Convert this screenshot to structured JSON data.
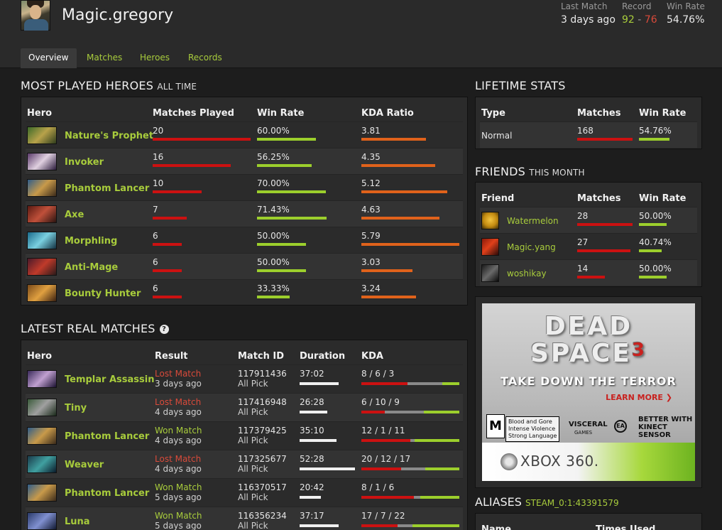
{
  "header": {
    "username": "Magic.gregory",
    "last_match_label": "Last Match",
    "last_match_value": "3 days ago",
    "record_label": "Record",
    "record_wins": "92",
    "record_sep": "-",
    "record_losses": "76",
    "win_rate_label": "Win Rate",
    "win_rate_value": "54.76%"
  },
  "tabs": [
    "Overview",
    "Matches",
    "Heroes",
    "Records"
  ],
  "most_played": {
    "title": "MOST PLAYED HEROES",
    "subtitle": "ALL TIME",
    "columns": [
      "Hero",
      "Matches Played",
      "Win Rate",
      "KDA Ratio"
    ],
    "rows": [
      {
        "hero": "Nature's Prophet",
        "matches": "20",
        "matches_frac": 1.0,
        "win_rate": "60.00%",
        "wr_frac": 0.6,
        "kda": "3.81",
        "kda_frac": 0.66
      },
      {
        "hero": "Invoker",
        "matches": "16",
        "matches_frac": 0.8,
        "win_rate": "56.25%",
        "wr_frac": 0.56,
        "kda": "4.35",
        "kda_frac": 0.75
      },
      {
        "hero": "Phantom Lancer",
        "matches": "10",
        "matches_frac": 0.5,
        "win_rate": "70.00%",
        "wr_frac": 0.7,
        "kda": "5.12",
        "kda_frac": 0.88
      },
      {
        "hero": "Axe",
        "matches": "7",
        "matches_frac": 0.35,
        "win_rate": "71.43%",
        "wr_frac": 0.71,
        "kda": "4.63",
        "kda_frac": 0.8
      },
      {
        "hero": "Morphling",
        "matches": "6",
        "matches_frac": 0.3,
        "win_rate": "50.00%",
        "wr_frac": 0.5,
        "kda": "5.79",
        "kda_frac": 1.0
      },
      {
        "hero": "Anti-Mage",
        "matches": "6",
        "matches_frac": 0.3,
        "win_rate": "50.00%",
        "wr_frac": 0.5,
        "kda": "3.03",
        "kda_frac": 0.52
      },
      {
        "hero": "Bounty Hunter",
        "matches": "6",
        "matches_frac": 0.3,
        "win_rate": "33.33%",
        "wr_frac": 0.33,
        "kda": "3.24",
        "kda_frac": 0.56
      }
    ]
  },
  "latest_matches": {
    "title": "LATEST REAL MATCHES",
    "help_icon_glyph": "?",
    "columns": [
      "Hero",
      "Result",
      "Match ID",
      "Duration",
      "KDA"
    ],
    "rows": [
      {
        "hero": "Templar Assassin",
        "result": "Lost Match",
        "won": false,
        "when": "3 days ago",
        "match_id": "117911436",
        "mode": "All Pick",
        "duration": "37:02",
        "dur_frac": 0.71,
        "kda": "8 / 6 / 3",
        "k": 8,
        "d": 6,
        "a": 3
      },
      {
        "hero": "Tiny",
        "result": "Lost Match",
        "won": false,
        "when": "4 days ago",
        "match_id": "117416948",
        "mode": "All Pick",
        "duration": "26:28",
        "dur_frac": 0.5,
        "kda": "6 / 10 / 9",
        "k": 6,
        "d": 10,
        "a": 9
      },
      {
        "hero": "Phantom Lancer",
        "result": "Won Match",
        "won": true,
        "when": "4 days ago",
        "match_id": "117379425",
        "mode": "All Pick",
        "duration": "35:10",
        "dur_frac": 0.67,
        "kda": "12 / 1 / 11",
        "k": 12,
        "d": 1,
        "a": 11
      },
      {
        "hero": "Weaver",
        "result": "Lost Match",
        "won": false,
        "when": "4 days ago",
        "match_id": "117325677",
        "mode": "All Pick",
        "duration": "52:28",
        "dur_frac": 1.0,
        "kda": "20 / 12 / 17",
        "k": 20,
        "d": 12,
        "a": 17
      },
      {
        "hero": "Phantom Lancer",
        "result": "Won Match",
        "won": true,
        "when": "5 days ago",
        "match_id": "116370517",
        "mode": "All Pick",
        "duration": "20:42",
        "dur_frac": 0.39,
        "kda": "8 / 1 / 6",
        "k": 8,
        "d": 1,
        "a": 6
      },
      {
        "hero": "Luna",
        "result": "Won Match",
        "won": true,
        "when": "5 days ago",
        "match_id": "116356234",
        "mode": "All Pick",
        "duration": "37:17",
        "dur_frac": 0.71,
        "kda": "17 / 7 / 22",
        "k": 17,
        "d": 7,
        "a": 22
      }
    ]
  },
  "lifetime": {
    "title": "LIFETIME STATS",
    "columns": [
      "Type",
      "Matches",
      "Win Rate"
    ],
    "rows": [
      {
        "type": "Normal",
        "matches": "168",
        "win_rate": "54.76%",
        "wr_frac": 0.55
      }
    ]
  },
  "friends": {
    "title": "FRIENDS",
    "subtitle": "THIS MONTH",
    "columns": [
      "Friend",
      "Matches",
      "Win Rate"
    ],
    "rows": [
      {
        "name": "Watermelon",
        "matches": "28",
        "m_frac": 1.0,
        "win_rate": "50.00%",
        "wr_frac": 0.5
      },
      {
        "name": "Magic.yang",
        "matches": "27",
        "m_frac": 0.96,
        "win_rate": "40.74%",
        "wr_frac": 0.41
      },
      {
        "name": "woshikay",
        "matches": "14",
        "m_frac": 0.5,
        "win_rate": "50.00%",
        "wr_frac": 0.5
      }
    ]
  },
  "ad": {
    "line1": "DEAD",
    "line2": "SPACE",
    "number": "3",
    "tagline": "TAKE DOWN THE TERROR",
    "cta": "LEARN MORE ❯",
    "rating": "M",
    "descriptors": "Blood and Gore\nIntense Violence\nStrong Language",
    "publisher": "VISCERAL",
    "publisher_sub": "GAMES",
    "ea": "EA",
    "kinect": "BETTER WITH\nKINECT\nSENSOR",
    "xbox": "XBOX 360."
  },
  "aliases": {
    "title": "ALIASES",
    "steam_id": "STEAM_0:1:43391579",
    "columns": [
      "Name",
      "Times Used"
    ]
  },
  "colors": {
    "accent_green": "#a8cc3c",
    "loss_red": "#d94a3a",
    "bar_red": "#cc1111",
    "bar_orange": "#e0621b",
    "bar_grey": "#8a8a8a"
  }
}
